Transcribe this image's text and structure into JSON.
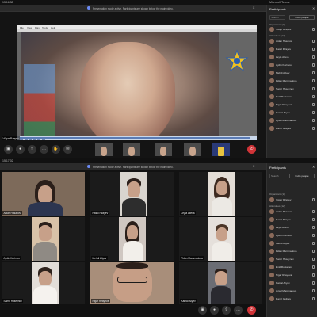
{
  "top_frame": {
    "status_time": "15:16:38",
    "status_right": "Microsoft Teams",
    "banner_text": "Presentation mode active. Participants are shown below the main video.",
    "banner_close": "X",
    "presenter_app_menu": [
      "File",
      "View",
      "Play",
      "Tools",
      "Help"
    ],
    "presenter_name": "Vüqar Rzayev",
    "logo_label": "ABŞ",
    "thumb_names": [
      "A",
      "B",
      "C",
      "D",
      "E"
    ],
    "participants_panel": {
      "title": "Participants",
      "search_placeholder": "Search",
      "invite_label": "Invite people",
      "section_organizers": "Organizers (1)",
      "section_attendees": "Attendees (12)",
      "people": [
        "Vüqar Rzayev",
        "Aidan Hasanov",
        "Rasul Rzayev",
        "Leyla Alieva",
        "Aydin Karimov",
        "Mehdi Aliyev",
        "Fidan Mammadova",
        "Samir Huseynov",
        "Emil Rustamov",
        "Nigar Rzayeva",
        "Kamal Aliyev",
        "Aysel Mammadova",
        "Ramil Guliyev"
      ]
    }
  },
  "bottom_frame": {
    "status_time": "15:17:02",
    "banner_text": "Presentation mode active. Participants are shown below the main video.",
    "banner_close": "X",
    "participants_panel": {
      "title": "Participants",
      "search_placeholder": "Search",
      "invite_label": "Invite people",
      "section_organizers": "Organizers (1)",
      "section_attendees": "Attendees (12)",
      "people": [
        "Vüqar Rzayev",
        "Aidan Hasanov",
        "Rasul Rzayev",
        "Leyla Alieva",
        "Aydin Karimov",
        "Mehdi Aliyev",
        "Fidan Mammadova",
        "Samir Huseynov",
        "Emil Rustamov",
        "Nigar Rzayeva",
        "Kamal Aliyev",
        "Aysel Mammadova",
        "Ramil Guliyev"
      ]
    },
    "tiles": [
      {
        "name": "Aidan Hasanov"
      },
      {
        "name": "Rasul Rzayev"
      },
      {
        "name": "Leyla Alieva"
      },
      {
        "name": "Aydin Karimov"
      },
      {
        "name": "Mehdi Aliyev"
      },
      {
        "name": "Fidan Mammadova"
      },
      {
        "name": "Samir Huseynov"
      },
      {
        "name": "Nigar Rzayeva"
      },
      {
        "name": "Kamal Aliyev"
      }
    ]
  },
  "colors": {
    "accent": "#6b8af5",
    "end_call": "#d13438",
    "panel_bg": "#262626"
  }
}
